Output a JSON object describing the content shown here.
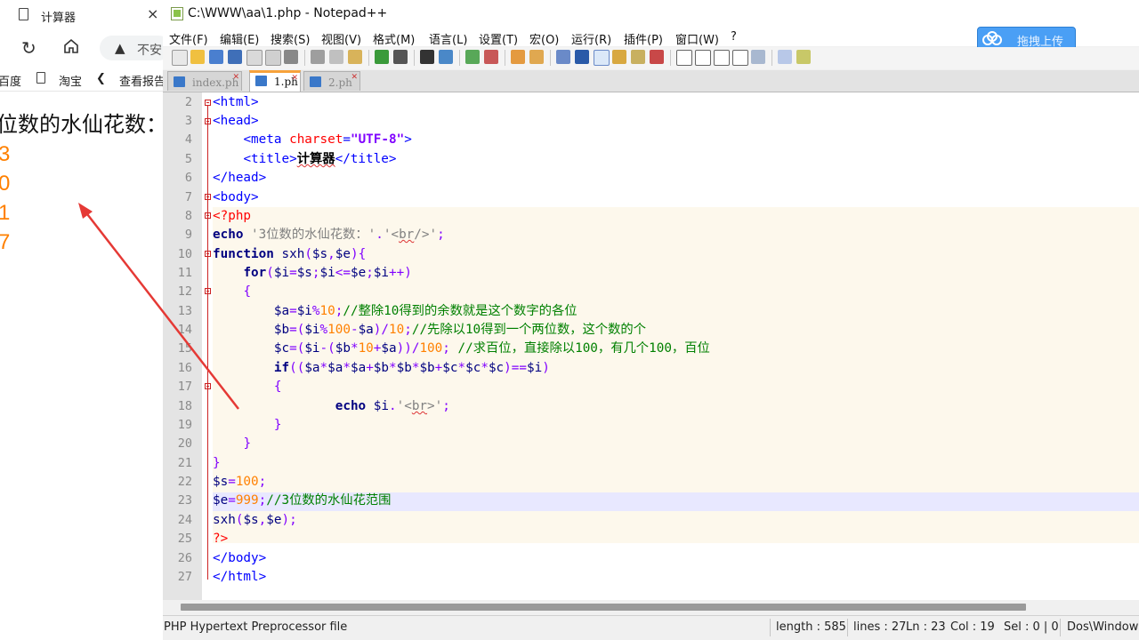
{
  "browser": {
    "tab_title": "计算器",
    "tab_close": "×",
    "address_insecure": "不安",
    "bookmarks": [
      "百度",
      "淘宝",
      "查看报告"
    ],
    "content": {
      "heading": "位数的水仙花数：",
      "results": [
        "3",
        "0",
        "1",
        "7"
      ]
    }
  },
  "notepad": {
    "window_title": "C:\\WWW\\aa\\1.php - Notepad++",
    "menu": [
      "文件(F)",
      "编辑(E)",
      "搜索(S)",
      "视图(V)",
      "格式(M)",
      "语言(L)",
      "设置(T)",
      "宏(O)",
      "运行(R)",
      "插件(P)",
      "窗口(W)",
      "?"
    ],
    "upload_button": "拖拽上传",
    "tabs": [
      {
        "label": "index.ph",
        "active": false
      },
      {
        "label": "1.ph",
        "active": true
      },
      {
        "label": "2.ph",
        "active": false
      }
    ],
    "line_numbers": [
      "2",
      "3",
      "4",
      "5",
      "6",
      "7",
      "8",
      "9",
      "10",
      "11",
      "12",
      "13",
      "14",
      "15",
      "16",
      "17",
      "18",
      "19",
      "20",
      "21",
      "22",
      "23",
      "24",
      "25",
      "26",
      "27"
    ],
    "current_line": "23",
    "status": {
      "file_type": "PHP Hypertext Preprocessor file",
      "length": "length : 585",
      "lines": "lines : 27",
      "ln": "Ln : 23",
      "col": "Col : 19",
      "sel": "Sel : 0 | 0",
      "eol": "Dos\\Window"
    }
  },
  "colors": {
    "keyword": "#000080",
    "tag": "#0000ff",
    "attribute": "#ff0000",
    "string": "#8000ff",
    "number": "#ff8000",
    "comment": "#008000",
    "php_bg": "#fdf8ec",
    "current_line_bg": "#e8e8ff",
    "annotation_arrow": "#e53935"
  }
}
